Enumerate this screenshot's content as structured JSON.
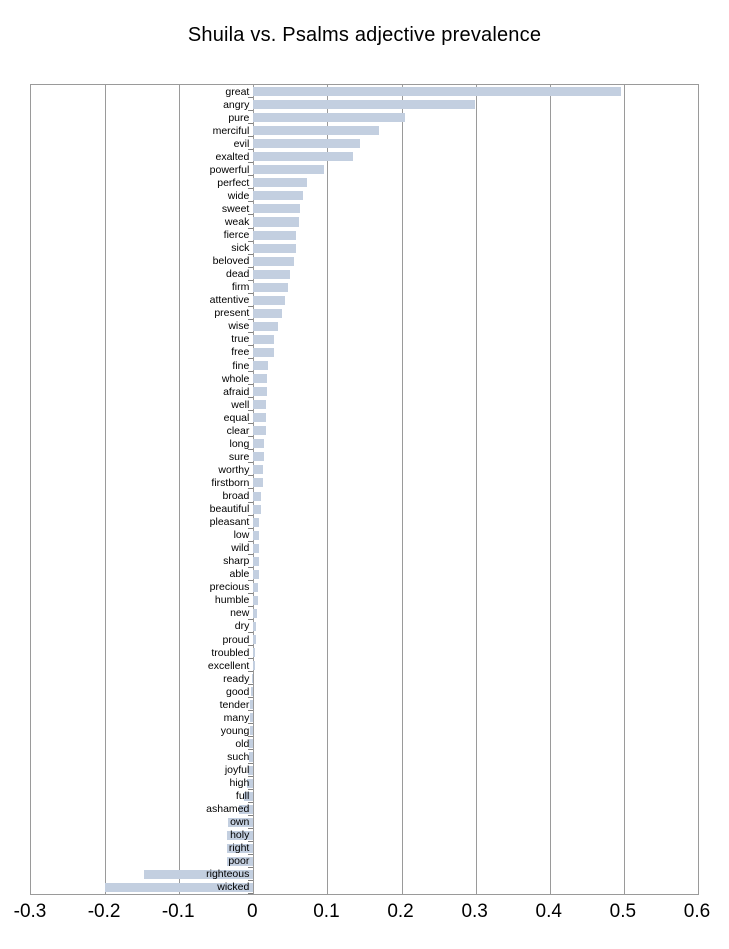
{
  "chart_data": {
    "type": "bar",
    "orientation": "horizontal",
    "title": "Shuila vs. Psalms adjective prevalence",
    "xlabel": "",
    "ylabel": "",
    "xlim": [
      -0.3,
      0.6
    ],
    "xticks": [
      "-0.3",
      "-0.2",
      "-0.1",
      "0",
      "0.1",
      "0.2",
      "0.3",
      "0.4",
      "0.5",
      "0.6"
    ],
    "xtick_values": [
      -0.3,
      -0.2,
      -0.1,
      0,
      0.1,
      0.2,
      0.3,
      0.4,
      0.5,
      0.6
    ],
    "grid": true,
    "legend": false,
    "bar_color": "#c3cfe0",
    "categories": [
      "great",
      "angry",
      "pure",
      "merciful",
      "evil",
      "exalted",
      "powerful",
      "perfect",
      "wide",
      "sweet",
      "weak",
      "fierce",
      "sick",
      "beloved",
      "dead",
      "firm",
      "attentive",
      "present",
      "wise",
      "true",
      "free",
      "fine",
      "whole",
      "afraid",
      "well",
      "equal",
      "clear",
      "long",
      "sure",
      "worthy",
      "firstborn",
      "broad",
      "beautiful",
      "pleasant",
      "low",
      "wild",
      "sharp",
      "able",
      "precious",
      "humble",
      "new",
      "dry",
      "proud",
      "troubled",
      "excellent",
      "ready",
      "good",
      "tender",
      "many",
      "young",
      "old",
      "such",
      "joyful",
      "high",
      "full",
      "ashamed",
      "own",
      "holy",
      "right",
      "poor",
      "righteous",
      "wicked"
    ],
    "values": [
      0.496,
      0.299,
      0.204,
      0.169,
      0.144,
      0.135,
      0.096,
      0.073,
      0.067,
      0.063,
      0.062,
      0.058,
      0.058,
      0.055,
      0.049,
      0.047,
      0.043,
      0.039,
      0.033,
      0.028,
      0.028,
      0.02,
      0.018,
      0.018,
      0.017,
      0.017,
      0.017,
      0.014,
      0.014,
      0.013,
      0.013,
      0.011,
      0.01,
      0.008,
      0.007,
      0.007,
      0.007,
      0.007,
      0.006,
      0.006,
      0.005,
      0.004,
      0.003,
      0.002,
      0.001,
      -0.002,
      -0.003,
      -0.004,
      -0.004,
      -0.005,
      -0.006,
      -0.006,
      -0.007,
      -0.008,
      -0.012,
      -0.02,
      -0.034,
      -0.035,
      -0.036,
      -0.036,
      -0.148,
      -0.2
    ]
  }
}
